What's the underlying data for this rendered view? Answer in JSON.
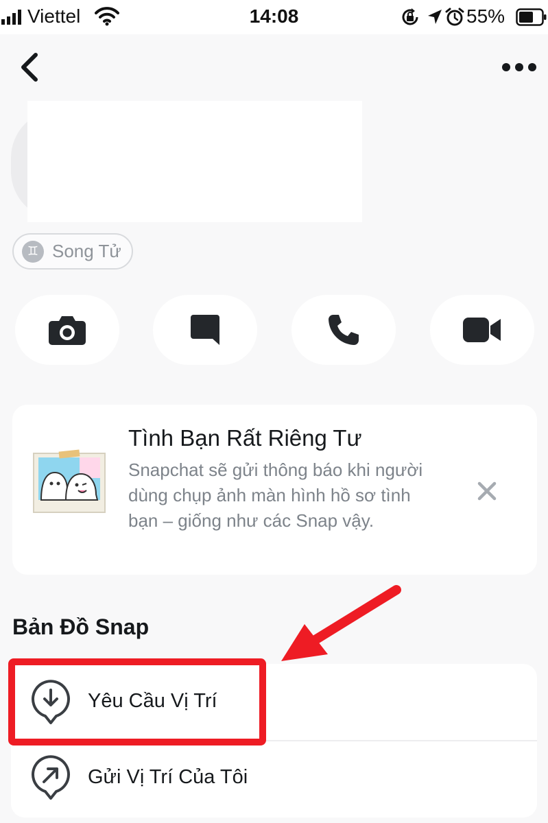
{
  "status_bar": {
    "carrier": "Viettel",
    "time": "14:08",
    "battery": "55%",
    "icons": [
      "signal-icon",
      "wifi-icon",
      "orientation-lock-icon",
      "location-icon",
      "alarm-icon",
      "battery-icon"
    ]
  },
  "header": {
    "back_icon": "chevron-left-icon",
    "more_icon": "more-dots-icon"
  },
  "profile": {
    "zodiac": "Song Tử",
    "zodiac_symbol": "♊"
  },
  "actions": [
    {
      "name": "camera",
      "icon": "camera-icon"
    },
    {
      "name": "chat",
      "icon": "chat-icon"
    },
    {
      "name": "call",
      "icon": "phone-icon"
    },
    {
      "name": "video",
      "icon": "video-icon"
    }
  ],
  "friendship_card": {
    "title": "Tình Bạn Rất Riêng Tư",
    "body": "Snapchat sẽ gửi thông báo khi người dùng chụp ảnh màn hình hồ sơ tình bạn – giống như các Snap vậy.",
    "close_icon": "close-icon"
  },
  "snap_map": {
    "section_title": "Bản Đồ Snap",
    "items": [
      {
        "label": "Yêu Cầu Vị Trí",
        "icon": "location-request-icon"
      },
      {
        "label": "Gửi Vị Trí Của Tôi",
        "icon": "location-send-icon"
      }
    ]
  },
  "colors": {
    "background": "#f8f8f9",
    "card": "#ffffff",
    "text_primary": "#16191c",
    "text_secondary": "#7d838a",
    "annotation_red": "#ee1c24"
  }
}
